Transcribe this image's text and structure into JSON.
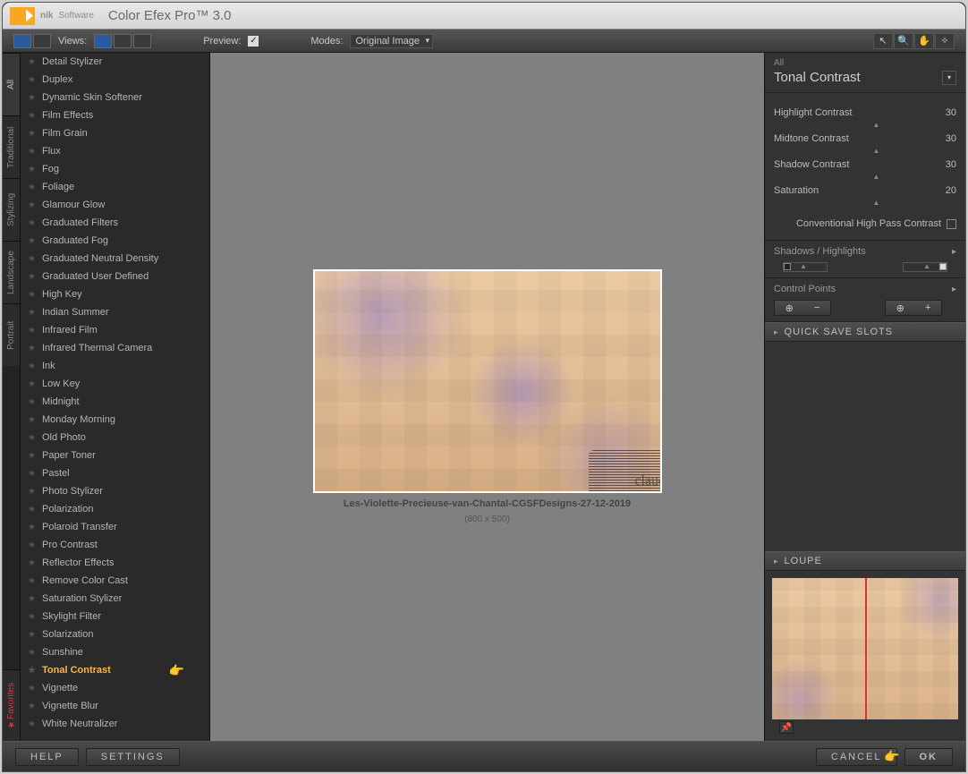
{
  "app": {
    "brand": "nik",
    "brand_sub": "Software",
    "title": "Color Efex Pro™ 3.0"
  },
  "toolbar": {
    "views_label": "Views:",
    "preview_label": "Preview:",
    "preview_checked": "✓",
    "modes_label": "Modes:",
    "mode_value": "Original Image",
    "tool_arrow": "↖",
    "tool_zoom": "🔍",
    "tool_hand": "✋",
    "tool_light": "✧"
  },
  "tabs": {
    "items": [
      "All",
      "Traditional",
      "Stylizing",
      "Landscape",
      "Portrait"
    ],
    "favorites": "Favorites"
  },
  "filters": [
    "Detail Stylizer",
    "Duplex",
    "Dynamic Skin Softener",
    "Film Effects",
    "Film Grain",
    "Flux",
    "Fog",
    "Foliage",
    "Glamour Glow",
    "Graduated Filters",
    "Graduated Fog",
    "Graduated Neutral Density",
    "Graduated User Defined",
    "High Key",
    "Indian Summer",
    "Infrared Film",
    "Infrared Thermal Camera",
    "Ink",
    "Low Key",
    "Midnight",
    "Monday Morning",
    "Old Photo",
    "Paper Toner",
    "Pastel",
    "Photo Stylizer",
    "Polarization",
    "Polaroid Transfer",
    "Pro Contrast",
    "Reflector Effects",
    "Remove Color Cast",
    "Saturation Stylizer",
    "Skylight Filter",
    "Solarization",
    "Sunshine",
    "Tonal Contrast",
    "Vignette",
    "Vignette Blur",
    "White Neutralizer"
  ],
  "selected_filter": "Tonal Contrast",
  "pointer_glyph": "👉",
  "image": {
    "caption": "Les-Violette-Precieuse-van-Chantal-CGSFDesigns-27-12-2019",
    "dims": "(800 x 500)",
    "watermark": "claudia"
  },
  "panel": {
    "category": "All",
    "title": "Tonal Contrast",
    "sliders": [
      {
        "label": "Highlight Contrast",
        "value": "30"
      },
      {
        "label": "Midtone Contrast",
        "value": "30"
      },
      {
        "label": "Shadow Contrast",
        "value": "30"
      },
      {
        "label": "Saturation",
        "value": "20"
      }
    ],
    "highpass": "Conventional High Pass Contrast",
    "shadows_hl": "Shadows / Highlights",
    "control_points": "Control Points",
    "cp_minus": "−",
    "cp_plus": "+",
    "quick_save": "QUICK SAVE SLOTS",
    "loupe": "LOUPE",
    "pin": "📌"
  },
  "footer": {
    "help": "HELP",
    "settings": "SETTINGS",
    "cancel": "CANCEL",
    "ok": "OK"
  }
}
